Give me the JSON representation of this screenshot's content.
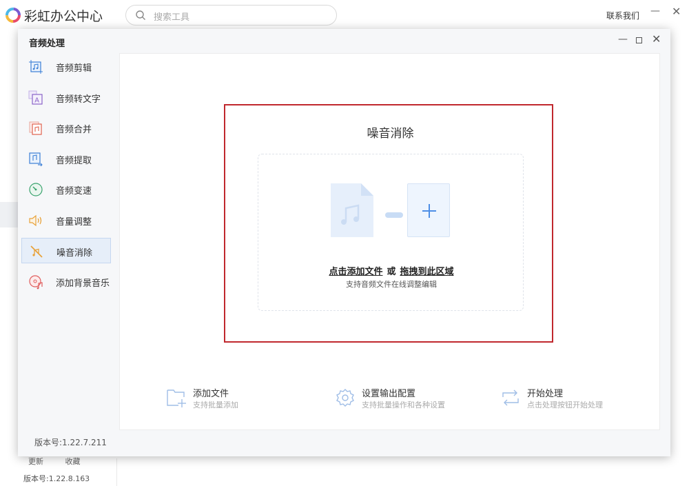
{
  "app": {
    "title": "彩虹办公中心",
    "contact_label": "联系我们"
  },
  "search": {
    "placeholder": "搜索工具"
  },
  "background": {
    "links": [
      "更新",
      "收藏"
    ],
    "version": "版本号:1.22.8.163"
  },
  "modal": {
    "title": "音频处理",
    "version": "版本号:1.22.7.211",
    "menu": [
      {
        "label": "音频剪辑",
        "icon": "audio-cut-icon",
        "color": "#3b7fd6"
      },
      {
        "label": "音频转文字",
        "icon": "audio-to-text-icon",
        "color": "#8a63c8"
      },
      {
        "label": "音频合并",
        "icon": "audio-merge-icon",
        "color": "#e0604c"
      },
      {
        "label": "音频提取",
        "icon": "audio-extract-icon",
        "color": "#3b7fd6"
      },
      {
        "label": "音频变速",
        "icon": "audio-speed-icon",
        "color": "#3aa36e"
      },
      {
        "label": "音量调整",
        "icon": "volume-adjust-icon",
        "color": "#e8a23a"
      },
      {
        "label": "噪音消除",
        "icon": "noise-removal-icon",
        "color": "#e8a23a",
        "active": true
      },
      {
        "label": "添加背景音乐",
        "icon": "add-bg-music-icon",
        "color": "#e05d5d"
      }
    ],
    "main": {
      "title": "噪音消除",
      "drop_link_add": "点击添加文件",
      "drop_or": "或",
      "drop_link_drag": "拖拽到此区域",
      "drop_sub": "支持音频文件在线调整编辑"
    },
    "steps": [
      {
        "title": "添加文件",
        "desc": "支持批量添加",
        "icon": "add-file-icon"
      },
      {
        "title": "设置输出配置",
        "desc": "支持批量操作和各种设置",
        "icon": "settings-gear-icon"
      },
      {
        "title": "开始处理",
        "desc": "点击处理按钮开始处理",
        "icon": "process-icon"
      }
    ]
  },
  "colors": {
    "accent": "#4d8ee6",
    "highlight": "#c0272d",
    "active_bg": "#e6eef9"
  }
}
